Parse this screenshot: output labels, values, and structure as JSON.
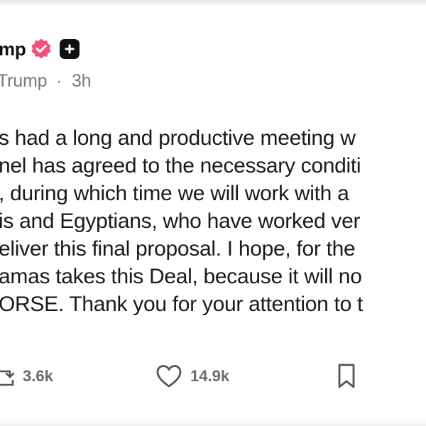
{
  "post": {
    "author_name": "mp",
    "handle_text": "Trump",
    "separator": "·",
    "time_ago": "3h",
    "body_lines": [
      "s had a long and productive meeting w",
      "nel has agreed to the necessary conditi",
      ", during which time we will work with a",
      "is and Egyptians, who have worked ver",
      "eliver this final proposal. I hope, for the",
      "amas takes this Deal, because it will no",
      "ORSE. Thank you for your attention to t"
    ]
  },
  "actions": {
    "repost_count": "3.6k",
    "like_count": "14.9k"
  },
  "icons": {
    "verified": "verified-badge-icon",
    "follow": "plus-icon",
    "repost": "repost-icon",
    "like": "heart-icon",
    "bookmark": "bookmark-icon"
  },
  "colors": {
    "verified_badge": "#f0527a",
    "text": "#1a1a1a",
    "muted": "#7a7a7a",
    "action_icon": "#555555"
  }
}
